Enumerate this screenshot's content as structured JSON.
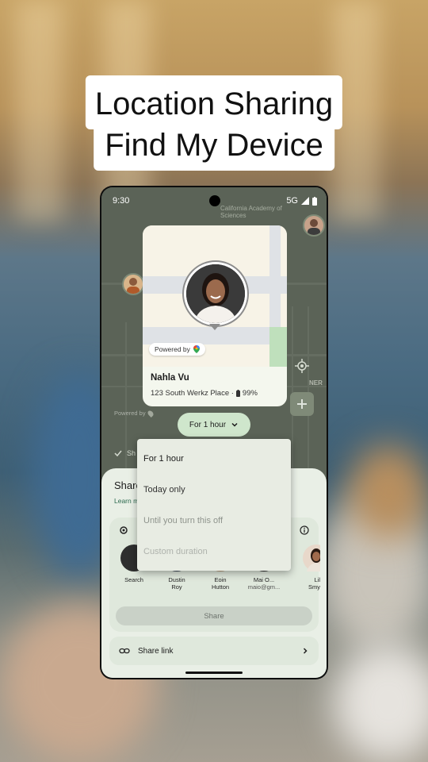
{
  "overlay": {
    "title_line1": "Location Sharing",
    "title_line2": "Find My Device"
  },
  "status_bar": {
    "time": "9:30",
    "network": "5G"
  },
  "map": {
    "poi_label": "California Academy of Sciences",
    "powered_by": "Powered by",
    "ner_label": "NER"
  },
  "location_card": {
    "powered_by": "Powered by",
    "name": "Nahla Vu",
    "address": "123 South Werkz Place ·",
    "battery": "99%"
  },
  "duration_chip": {
    "label": "For 1 hour"
  },
  "dropdown": {
    "options": [
      {
        "label": "For 1 hour",
        "enabled": true
      },
      {
        "label": "Today only",
        "enabled": true
      },
      {
        "label": "Until you turn this off",
        "enabled": false
      },
      {
        "label": "Custom duration",
        "enabled": false
      }
    ]
  },
  "sheet": {
    "heading": "Share",
    "learn_more": "Learn m",
    "checkbox_label": "Sh",
    "contacts": [
      {
        "name": "Search",
        "detail": ""
      },
      {
        "name": "Dustin",
        "detail": "Roy"
      },
      {
        "name": "Eoin",
        "detail": "Hutton"
      },
      {
        "name": "Mai O...",
        "detail": "maio@gm..."
      },
      {
        "name": "Lil",
        "detail": "Smy"
      }
    ],
    "share_button": "Share",
    "share_link": "Share link"
  },
  "colors": {
    "chip_bg": "#cfe6cc",
    "sheet_bg": "#e9efe6",
    "accent_green": "#2d6a4f"
  }
}
